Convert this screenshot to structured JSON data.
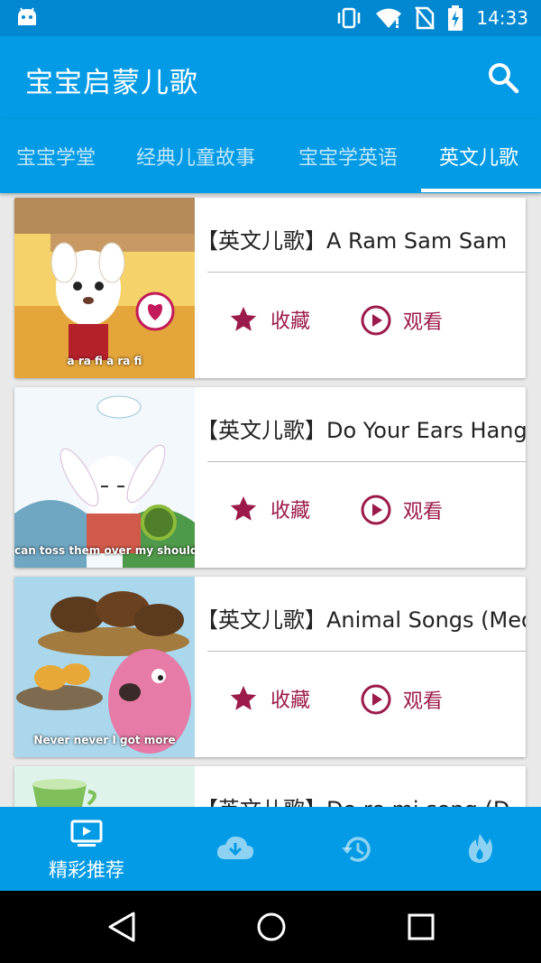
{
  "status_bar": {
    "time": "14:33"
  },
  "app_bar": {
    "title": "宝宝启蒙儿歌",
    "search_icon": "search-icon"
  },
  "tabs": [
    {
      "label": "宝宝学堂",
      "active": false
    },
    {
      "label": "经典儿童故事",
      "active": false
    },
    {
      "label": "宝宝学英语",
      "active": false
    },
    {
      "label": "英文儿歌",
      "active": true
    }
  ],
  "videos": [
    {
      "title": "【英文儿歌】A Ram Sam Sam",
      "thumb_caption": "a ra fi a ra fi",
      "favorite_label": "收藏",
      "watch_label": "观看"
    },
    {
      "title": "【英文儿歌】Do Your Ears Hang Low",
      "thumb_caption": "can toss them over my should",
      "favorite_label": "收藏",
      "watch_label": "观看"
    },
    {
      "title": "【英文儿歌】Animal Songs (Medley)",
      "thumb_caption": "Never never I got more",
      "favorite_label": "收藏",
      "watch_label": "观看"
    },
    {
      "title": "【英文儿歌】Do re mi song (D",
      "thumb_caption": "",
      "favorite_label": "收藏",
      "watch_label": "观看"
    }
  ],
  "bottom_nav": [
    {
      "label": "精彩推荐",
      "icon": "tv-play-icon",
      "active": true
    },
    {
      "label": "",
      "icon": "cloud-download-icon",
      "active": false
    },
    {
      "label": "",
      "icon": "history-icon",
      "active": false
    },
    {
      "label": "",
      "icon": "fire-icon",
      "active": false
    }
  ],
  "colors": {
    "primary": "#039be5",
    "status_bar": "#0288d1",
    "accent": "#9c1a4b"
  }
}
